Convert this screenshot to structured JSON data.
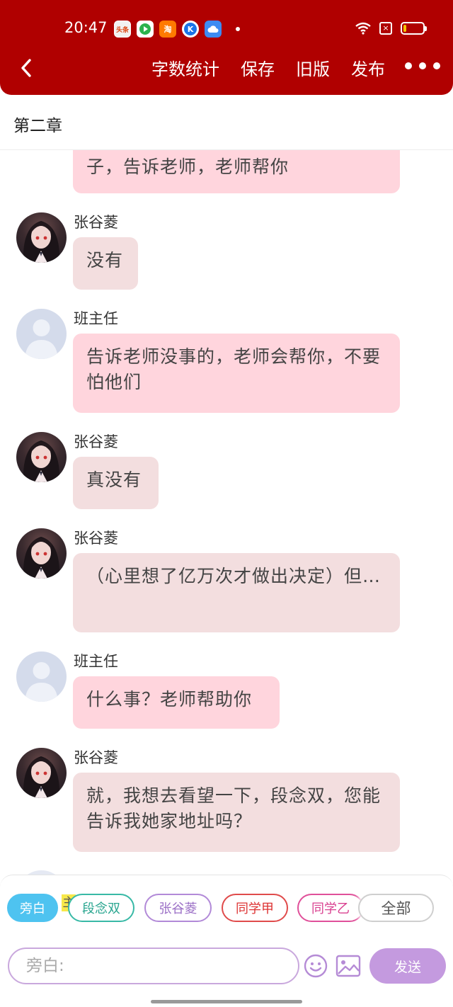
{
  "status_bar": {
    "time": "20:47",
    "apps": [
      {
        "icon": "toutiao-app-icon",
        "text": "头条"
      },
      {
        "icon": "video-app-icon",
        "text": ""
      },
      {
        "icon": "taobao-app-icon",
        "text": "淘"
      },
      {
        "icon": "kugou-app-icon",
        "text": "K"
      },
      {
        "icon": "cloud-app-icon",
        "text": ""
      }
    ],
    "battery_level": 0.15,
    "colors": {
      "battery": "#f5c400"
    }
  },
  "toolbar": {
    "actions": [
      "字数统计",
      "保存",
      "旧版",
      "发布"
    ],
    "background": "#b00000"
  },
  "chapter": {
    "title": "第二章"
  },
  "messages": [
    {
      "sender": "",
      "avatar": "",
      "style": "pink",
      "text": "子，告诉老师，老师帮你"
    },
    {
      "sender": "张谷菱",
      "avatar": "girl-avatar",
      "style": "beige",
      "text": "没有"
    },
    {
      "sender": "班主任",
      "avatar": "default-avatar",
      "style": "pink",
      "text": "告诉老师没事的，老师会帮你，不要怕他们"
    },
    {
      "sender": "张谷菱",
      "avatar": "girl-avatar",
      "style": "beige",
      "text": "真没有"
    },
    {
      "sender": "张谷菱",
      "avatar": "girl-avatar",
      "style": "beige",
      "text": "（心里想了亿万次才做出决定）但…"
    },
    {
      "sender": "班主任",
      "avatar": "default-avatar",
      "style": "pink",
      "text": "什么事？老师帮助你"
    },
    {
      "sender": "张谷菱",
      "avatar": "girl-avatar",
      "style": "beige",
      "text": "就，我想去看望一下，段念双，您能告诉我她家地址吗？"
    }
  ],
  "roles": {
    "narrator": "旁白",
    "protagonist_tag": "主",
    "characters": [
      "段念双",
      "张谷菱",
      "同学甲",
      "同学乙"
    ],
    "all": "全部"
  },
  "composer": {
    "placeholder": "旁白:",
    "send": "发送",
    "colors": {
      "send": "#c49adf",
      "narrator_chip": "#4ec3f0"
    }
  }
}
